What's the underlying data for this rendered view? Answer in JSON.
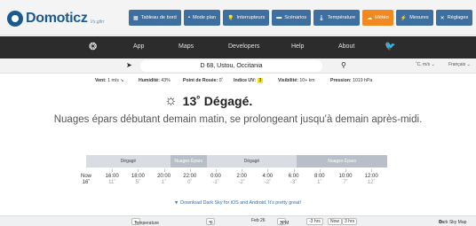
{
  "header": {
    "logo_text": "Domoticz",
    "logo_sub": "Vs.gltrr",
    "tabs": [
      {
        "label": "Tableau de bord",
        "icon": "dashboard-icon",
        "glyph": "▦"
      },
      {
        "label": "Mode plan",
        "icon": "plan-icon",
        "glyph": "▪"
      },
      {
        "label": "Interrupteurs",
        "icon": "lightbulb-icon",
        "glyph": "💡"
      },
      {
        "label": "Scénarios",
        "icon": "scene-icon",
        "glyph": "▬"
      },
      {
        "label": "Température",
        "icon": "thermometer-icon",
        "glyph": "🌡"
      },
      {
        "label": "Météo",
        "icon": "weather-cloud-icon",
        "glyph": "☁"
      },
      {
        "label": "Mesures",
        "icon": "measures-icon",
        "glyph": "⚡"
      },
      {
        "label": "Réglages",
        "icon": "settings-icon",
        "glyph": "✕"
      }
    ],
    "active_tab_index": 5,
    "active_tab_color": "#f08a20",
    "tab_color": "#3d6fa0"
  },
  "darksky_nav": {
    "items": [
      "App",
      "Maps",
      "Developers",
      "Help",
      "About"
    ],
    "logo_icon": "darksky-logo-icon",
    "social_icon": "twitter-icon"
  },
  "search": {
    "location": "D 68, Ustou, Occitania",
    "units": "˚C, m/s",
    "language": "Français"
  },
  "conditions": {
    "wind_label": "Vent:",
    "wind_value": "1 m/s ↘",
    "humidity_label": "Humidité:",
    "humidity_value": "43%",
    "dewpoint_label": "Point de Rosée:",
    "dewpoint_value": "0˚",
    "uv_label": "Indice UV:",
    "uv_value": "3",
    "visibility_label": "Visibilité:",
    "visibility_value": "10+ km",
    "pressure_label": "Pression:",
    "pressure_value": "1019 hPa"
  },
  "current": {
    "summary": "13˚ Dégagé.",
    "icon": "sun-icon",
    "forecast": "Nuages épars débutant demain matin, se prolongeant jusqu'à demain après-midi."
  },
  "timeline": {
    "segments": [
      {
        "label": "Dégagé",
        "kind": "clear",
        "share": 0.28
      },
      {
        "label": "Nuages Épars",
        "kind": "partly",
        "share": 0.12
      },
      {
        "label": "Dégagé",
        "kind": "clear",
        "share": 0.3
      },
      {
        "label": "Nuages Épars",
        "kind": "partly",
        "share": 0.3
      }
    ],
    "hours": [
      {
        "time": "Now",
        "temp": "16˚",
        "now": true
      },
      {
        "time": "16:00",
        "temp": "11˚"
      },
      {
        "time": "18:00",
        "temp": "5˚"
      },
      {
        "time": "20:00",
        "temp": "1˚"
      },
      {
        "time": "22:00",
        "temp": "0˚"
      },
      {
        "time": "0:00",
        "temp": "-1˚"
      },
      {
        "time": "2:00",
        "temp": "-2˚"
      },
      {
        "time": "4:00",
        "temp": "-2˚"
      },
      {
        "time": "6:00",
        "temp": "-3˚"
      },
      {
        "time": "8:00",
        "temp": "1˚"
      },
      {
        "time": "10:00",
        "temp": "7˚"
      },
      {
        "time": "12:00",
        "temp": "12˚"
      }
    ]
  },
  "download_text": "Download Dark Sky for iOS and Android. It's pretty great!",
  "map_toolbar": {
    "layer": "Temperature",
    "unit": "°F",
    "date": "Feb 26",
    "time": "3PM",
    "step_back": "-3 hrs",
    "now": "Now",
    "step_forward": "3 hrs",
    "brand": "Dark Sky Map"
  }
}
